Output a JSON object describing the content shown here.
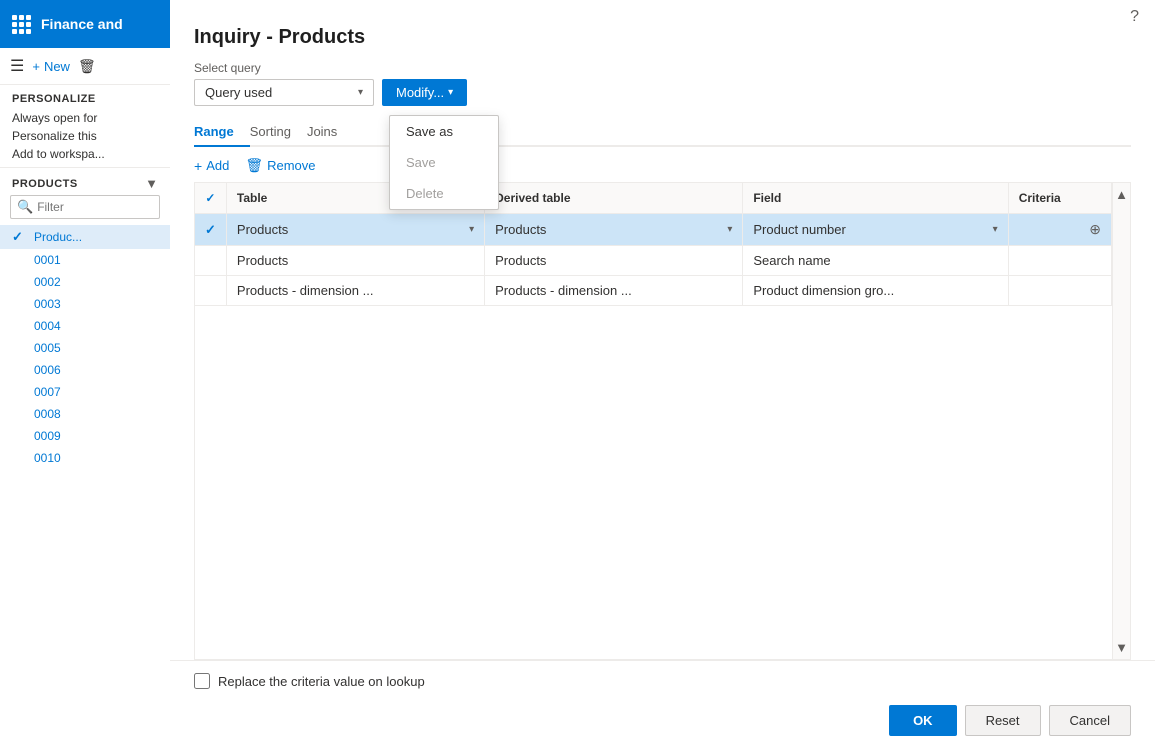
{
  "app": {
    "name": "Finance and",
    "help_icon": "?"
  },
  "sidebar": {
    "toolbar": {
      "hamburger_icon": "☰",
      "new_label": "New",
      "plus_icon": "+",
      "delete_icon": "🗑"
    },
    "personalize": {
      "title": "PERSONALIZE",
      "items": [
        "Always open for",
        "Personalize this",
        "Add to workspa..."
      ]
    },
    "products": {
      "title": "PRODUCTS",
      "filter_placeholder": "Filter",
      "rows": [
        {
          "id": "Produc...",
          "selected": true,
          "check": true
        },
        {
          "id": "0001",
          "selected": false,
          "check": false
        },
        {
          "id": "0002",
          "selected": false,
          "check": false
        },
        {
          "id": "0003",
          "selected": false,
          "check": false
        },
        {
          "id": "0004",
          "selected": false,
          "check": false
        },
        {
          "id": "0005",
          "selected": false,
          "check": false
        },
        {
          "id": "0006",
          "selected": false,
          "check": false
        },
        {
          "id": "0007",
          "selected": false,
          "check": false
        },
        {
          "id": "0008",
          "selected": false,
          "check": false
        },
        {
          "id": "0009",
          "selected": false,
          "check": false
        },
        {
          "id": "0010",
          "selected": false,
          "check": false
        }
      ]
    }
  },
  "dialog": {
    "title": "Inquiry - Products",
    "select_query_label": "Select query",
    "query_value": "Query used",
    "modify_button_label": "Modify...",
    "dropdown": {
      "items": [
        {
          "label": "Save as",
          "disabled": false
        },
        {
          "label": "Save",
          "disabled": true
        },
        {
          "label": "Delete",
          "disabled": true
        }
      ]
    },
    "tabs": [
      {
        "label": "Range",
        "active": true
      },
      {
        "label": "Sorting",
        "active": false
      },
      {
        "label": "Joins",
        "active": false
      }
    ],
    "toolbar": {
      "add_label": "Add",
      "remove_label": "Remove"
    },
    "table": {
      "columns": [
        {
          "label": ""
        },
        {
          "label": "Table"
        },
        {
          "label": "Derived table"
        },
        {
          "label": "Field"
        },
        {
          "label": "Criteria"
        }
      ],
      "rows": [
        {
          "check": true,
          "table": "Products",
          "derived_table": "Products",
          "field": "Product number",
          "criteria": "",
          "highlighted": true
        },
        {
          "check": false,
          "table": "Products",
          "derived_table": "Products",
          "field": "Search name",
          "criteria": "",
          "highlighted": false
        },
        {
          "check": false,
          "table": "Products - dimension ...",
          "derived_table": "Products - dimension ...",
          "field": "Product dimension gro...",
          "criteria": "",
          "highlighted": false
        }
      ]
    },
    "checkbox": {
      "label": "Replace the criteria value on lookup",
      "checked": false
    },
    "buttons": {
      "ok": "OK",
      "reset": "Reset",
      "cancel": "Cancel"
    }
  }
}
